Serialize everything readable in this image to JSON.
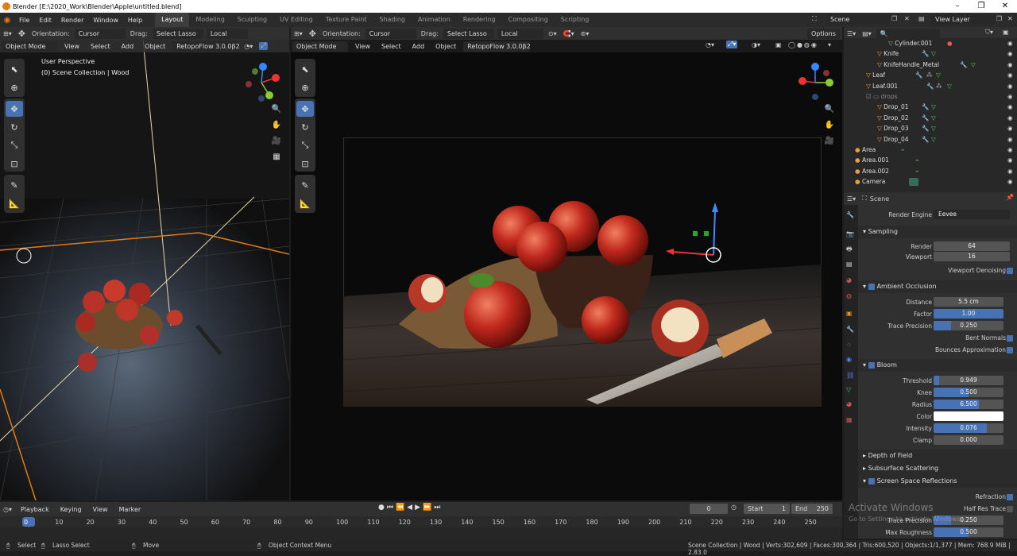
{
  "window": {
    "title": "Blender [E:\\2020_Work\\Blender\\Apple\\untitled.blend]"
  },
  "menu": [
    "File",
    "Edit",
    "Render",
    "Window",
    "Help"
  ],
  "workspaces": [
    "Layout",
    "Modeling",
    "Sculpting",
    "UV Editing",
    "Texture Paint",
    "Shading",
    "Animation",
    "Rendering",
    "Compositing",
    "Scripting"
  ],
  "scene": {
    "name": "Scene",
    "view_layer": "View Layer"
  },
  "left_header": {
    "orientation_label": "Orientation:",
    "orientation": "Cursor",
    "drag_label": "Drag:",
    "drag": "Select Lasso",
    "transform": "Local"
  },
  "right_header": {
    "orientation_label": "Orientation:",
    "orientation": "Cursor",
    "drag_label": "Drag:",
    "drag": "Select Lasso",
    "transform": "Local",
    "options": "Options"
  },
  "left_vp": {
    "mode": "Object Mode",
    "menus": [
      "View",
      "Select",
      "Add",
      "Object"
    ],
    "addon": "RetopoFlow 3.0.0β2",
    "overlay_title": "User Perspective",
    "overlay_sub": "(0) Scene Collection | Wood"
  },
  "right_vp": {
    "mode": "Object Mode",
    "menus": [
      "View",
      "Select",
      "Add",
      "Object"
    ],
    "addon": "RetopoFlow 3.0.0β2"
  },
  "outliner": {
    "rows": [
      "Cylinder.001",
      "Knife",
      "KnifeHandle_Metal",
      "Leaf",
      "Leaf.001",
      "drops",
      "Drop_01",
      "Drop_02",
      "Drop_03",
      "Drop_04",
      "Area",
      "Area.001",
      "Area.002",
      "Camera"
    ]
  },
  "properties": {
    "header": "Scene",
    "render_engine_label": "Render Engine",
    "render_engine": "Eevee",
    "sampling": {
      "title": "Sampling",
      "render_label": "Render",
      "render": "64",
      "viewport_label": "Viewport",
      "viewport": "16",
      "denoise": "Viewport Denoising"
    },
    "ao": {
      "title": "Ambient Occlusion",
      "distance_label": "Distance",
      "distance": "5.5 cm",
      "factor_label": "Factor",
      "factor": "1.00",
      "trace_label": "Trace Precision",
      "trace": "0.250",
      "bent": "Bent Normals",
      "bounces": "Bounces Approximation"
    },
    "bloom": {
      "title": "Bloom",
      "threshold_label": "Threshold",
      "threshold": "0.949",
      "knee_label": "Knee",
      "knee": "0.500",
      "radius_label": "Radius",
      "radius": "6.500",
      "color_label": "Color",
      "intensity_label": "Intensity",
      "intensity": "0.076",
      "clamp_label": "Clamp",
      "clamp": "0.000"
    },
    "dof": "Depth of Field",
    "sss": "Subsurface Scattering",
    "ssr": {
      "title": "Screen Space Reflections",
      "refraction": "Refraction",
      "half_res": "Half Res Trace",
      "trace_label": "Trace Precision",
      "trace": "0.250",
      "roughness_label": "Max Roughness",
      "roughness": "0.500"
    }
  },
  "watermark": {
    "line1": "Activate Windows",
    "line2": "Go to Settings to activate Windows."
  },
  "timeline": {
    "menus": [
      "Playback",
      "Keying",
      "View",
      "Marker"
    ],
    "current": "0",
    "start_label": "Start",
    "start": "1",
    "end_label": "End",
    "end": "250",
    "ticks": [
      "0",
      "10",
      "20",
      "30",
      "40",
      "50",
      "60",
      "70",
      "80",
      "90",
      "100",
      "110",
      "120",
      "130",
      "140",
      "150",
      "160",
      "170",
      "180",
      "190",
      "200",
      "210",
      "220",
      "230",
      "240",
      "250"
    ]
  },
  "status": {
    "select": "Select",
    "lasso": "Lasso Select",
    "move": "Move",
    "context": "Object Context Menu",
    "stats": "Scene Collection | Wood | Verts:302,609 | Faces:300,364 | Tris:600,520 | Objects:1/1,377 | Mem: 768.9 MiB | 2.83.0"
  }
}
